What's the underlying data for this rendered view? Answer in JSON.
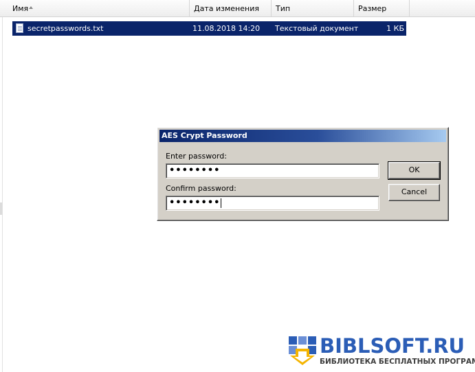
{
  "columns": {
    "name": "Имя",
    "date": "Дата изменения",
    "type": "Тип",
    "size": "Размер"
  },
  "file": {
    "name": "secretpasswords.txt",
    "date": "11.08.2018 14:20",
    "type": "Текстовый документ",
    "size": "1 КБ"
  },
  "dialog": {
    "title": "AES Crypt Password",
    "enter_label": "Enter password:",
    "enter_value": "••••••••",
    "confirm_label": "Confirm password:",
    "confirm_value": "••••••••",
    "ok_label": "OK",
    "cancel_label": "Cancel"
  },
  "watermark": {
    "title": "BIBLSOFT.RU",
    "subtitle": "БИБЛИОТЕКА БЕСПЛАТНЫХ ПРОГРАММ"
  },
  "colors": {
    "selection": "#0a246a",
    "dialog_bg": "#d4d0c8",
    "watermark_blue": "#2b5db6"
  }
}
